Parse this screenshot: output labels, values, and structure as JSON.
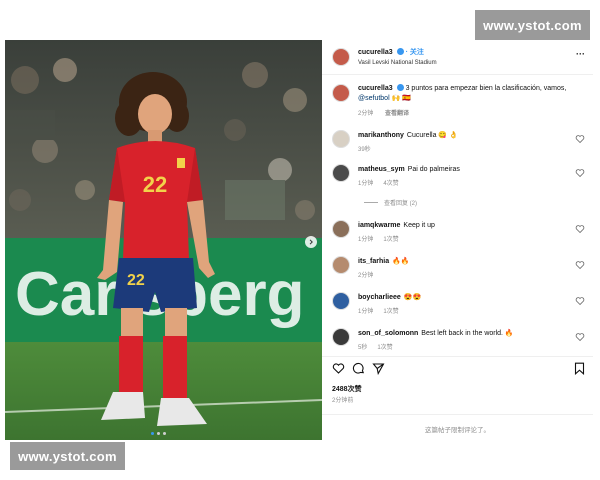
{
  "watermark": {
    "top": "www.ystot.com",
    "bottom": "www.ystot.com"
  },
  "header": {
    "username": "cucurella3",
    "follow": "· 关注",
    "location": "Vasil Levski National Stadium",
    "more": "···"
  },
  "caption": {
    "username": "cucurella3",
    "text": "3 puntos para empezar bien la clasificación, vamos,",
    "mention": "@sefutbol",
    "emoji": "🙌 🇪🇸",
    "time": "2分钟",
    "translate": "查看翻译"
  },
  "comments": [
    {
      "username": "marikanthony",
      "text": "Cucurella 😋 👌",
      "time": "39秒",
      "likes": ""
    },
    {
      "username": "matheus_sym",
      "text": "Pai do palmeiras",
      "time": "1分钟",
      "likes": "4次赞",
      "replies": "查看回复 (2)"
    },
    {
      "username": "iamqkwarme",
      "text": "Keep it up",
      "time": "1分钟",
      "likes": "1次赞"
    },
    {
      "username": "its_farhia",
      "text": "🔥🔥",
      "time": "2分钟",
      "likes": ""
    },
    {
      "username": "boycharlieee",
      "text": "😍😍",
      "time": "1分钟",
      "likes": "1次赞"
    },
    {
      "username": "son_of_solomonn",
      "text": "Best left back in the world. 🔥",
      "time": "5秒",
      "likes": "1次赞"
    }
  ],
  "actions": {
    "likes": "2488次赞",
    "time": "2分钟前"
  },
  "footer": {
    "notice": "这篇帖子限制评论了。"
  },
  "photo": {
    "jersey_number": "22",
    "banner_text": "Carlsberg"
  },
  "colors": {
    "jersey": "#d8222b",
    "shorts": "#1c3a7a",
    "banner": "#1b8a4f",
    "pitch": "#4f8f3c",
    "verified": "#3897f0"
  }
}
